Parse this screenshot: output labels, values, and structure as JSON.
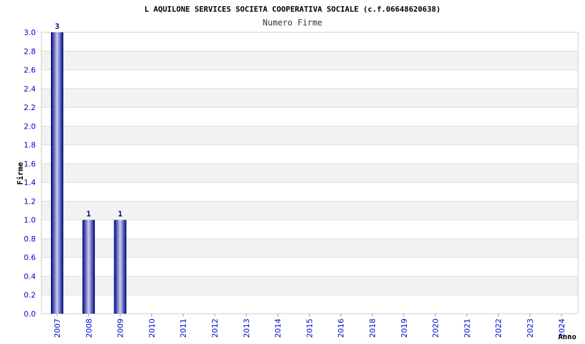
{
  "chart_data": {
    "type": "bar",
    "title": "L AQUILONE SERVICES SOCIETA COOPERATIVA SOCIALE (c.f.06648620638)",
    "subtitle": "Numero Firme",
    "xlabel": "Anno",
    "ylabel": "Firme",
    "categories": [
      "2007",
      "2008",
      "2009",
      "2010",
      "2011",
      "2012",
      "2013",
      "2014",
      "2015",
      "2016",
      "2018",
      "2019",
      "2020",
      "2021",
      "2022",
      "2023",
      "2024"
    ],
    "values": [
      3,
      1,
      1,
      0,
      0,
      0,
      0,
      0,
      0,
      0,
      0,
      0,
      0,
      0,
      0,
      0,
      0
    ],
    "data_labels": [
      "3",
      "1",
      "1",
      "",
      "",
      "",
      "",
      "",
      "",
      "",
      "",
      "",
      "",
      "",
      "",
      "",
      ""
    ],
    "ylim": [
      0,
      3.0
    ],
    "yticks": [
      "0.0",
      "0.2",
      "0.4",
      "0.6",
      "0.8",
      "1.0",
      "1.2",
      "1.4",
      "1.6",
      "1.8",
      "2.0",
      "2.2",
      "2.4",
      "2.6",
      "2.8",
      "3.0"
    ],
    "grid": true,
    "colors": {
      "bar_dark": "#000080",
      "bar_light": "#c8d0f0",
      "tick_label": "#0000cc",
      "band": "#f2f2f2",
      "grid": "#dddddd"
    }
  }
}
